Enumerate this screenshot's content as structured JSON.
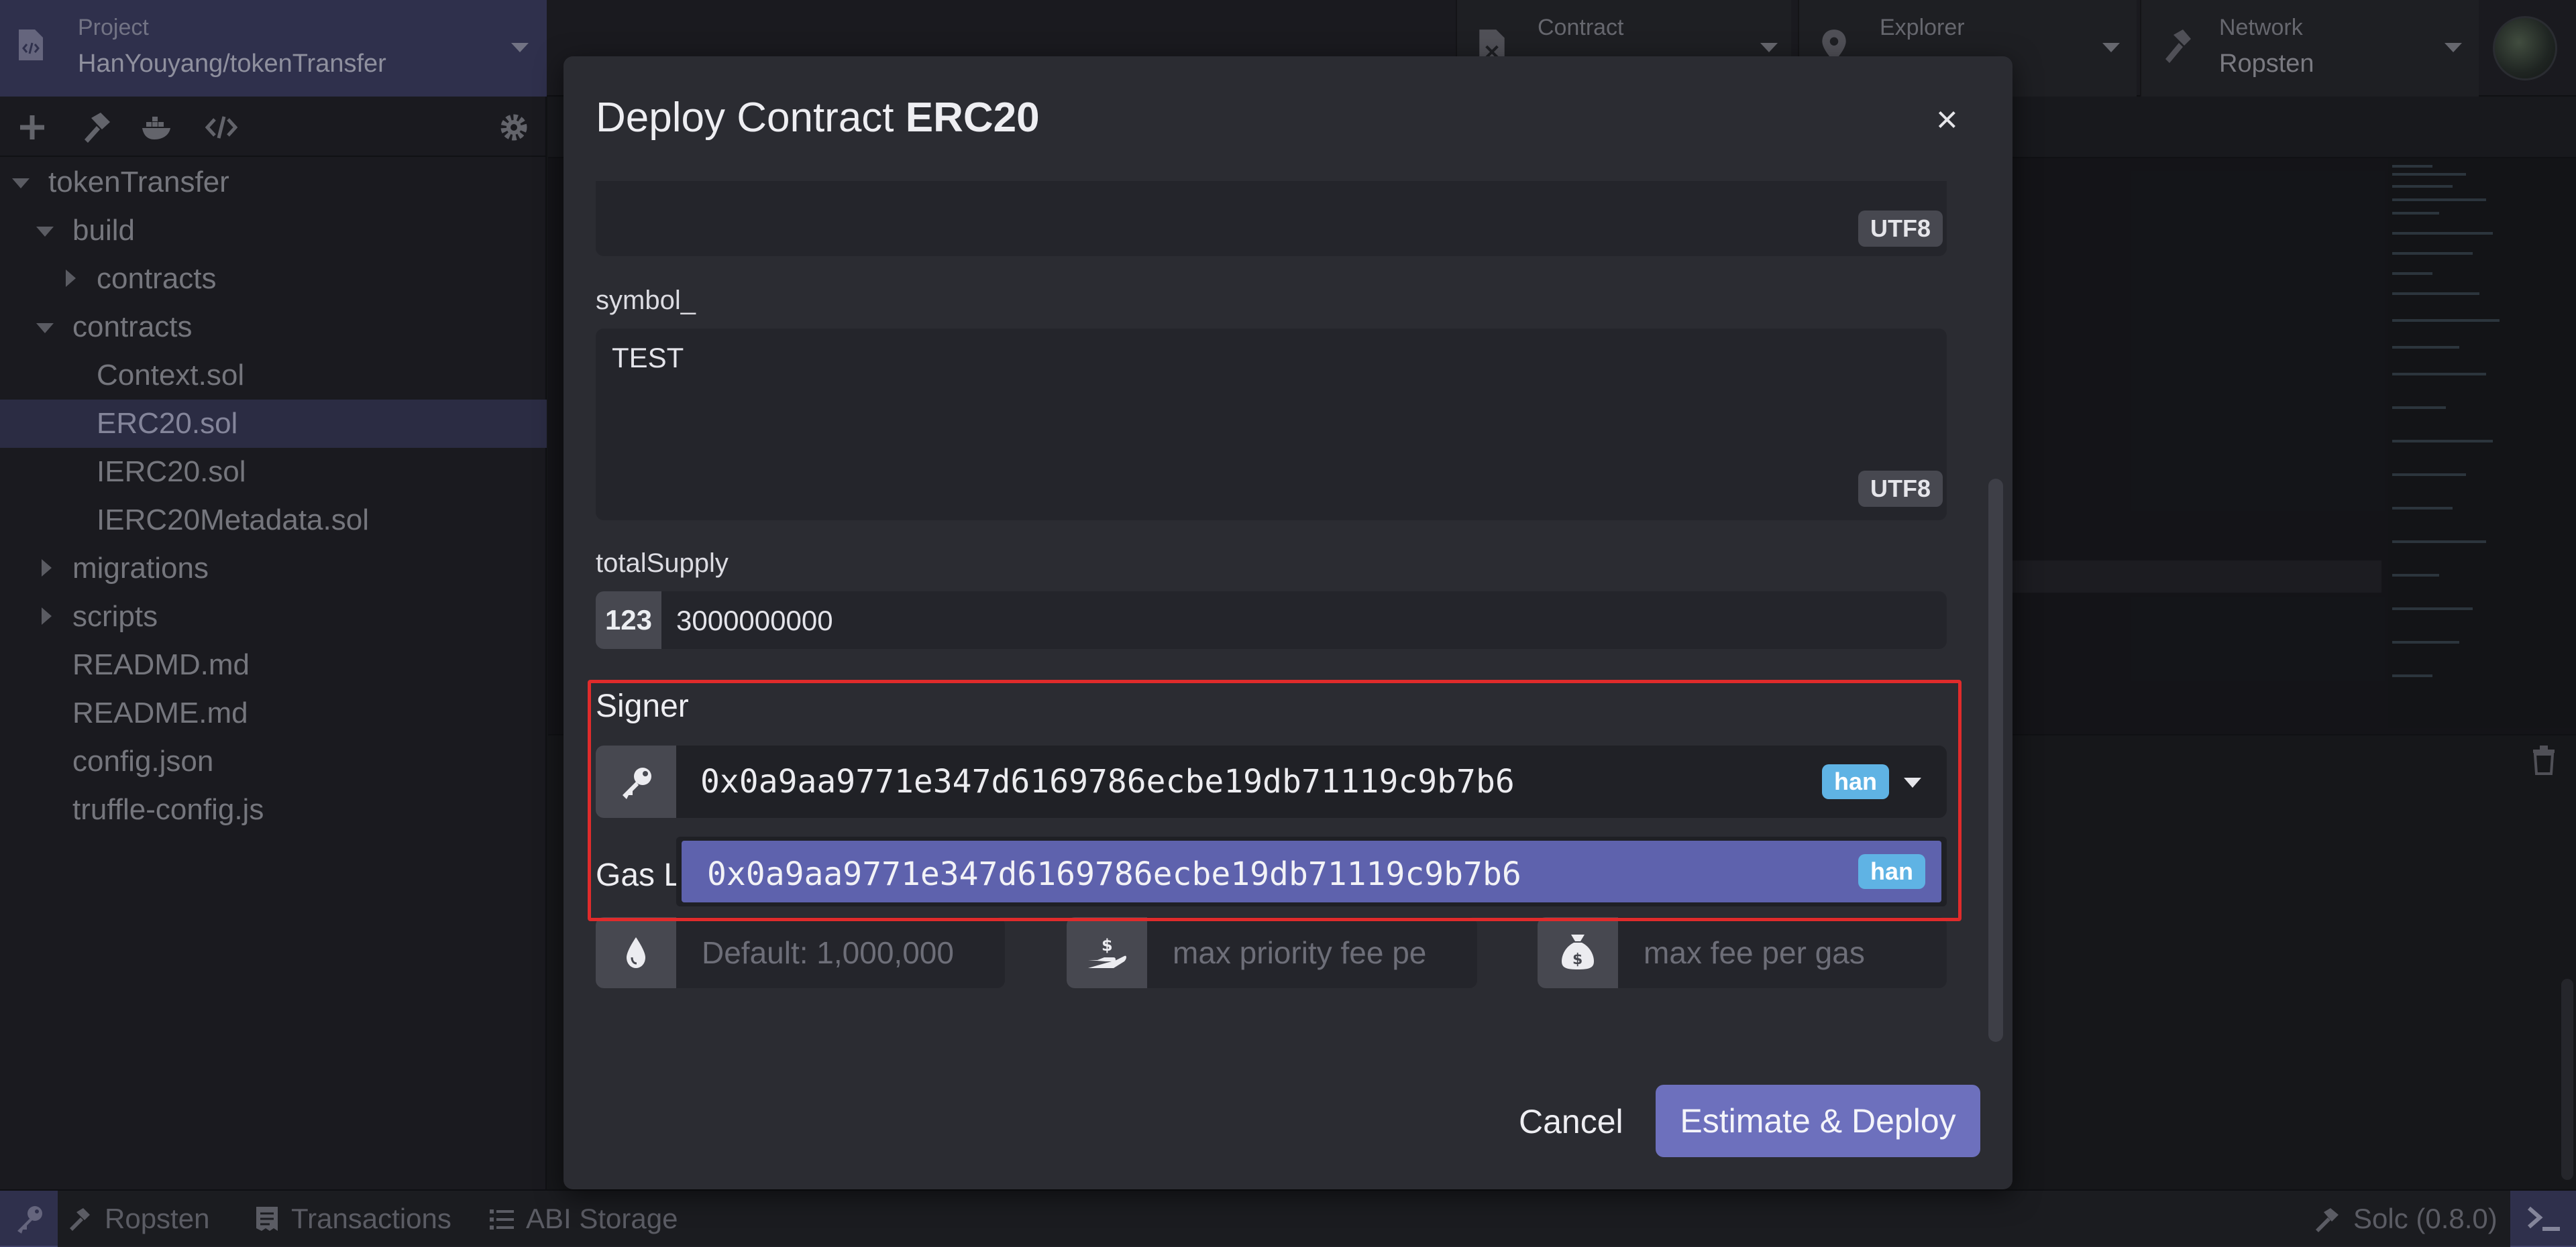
{
  "topbar": {
    "project_label": "Project",
    "project_name": "HanYouyang/tokenTransfer",
    "contract_label": "Contract",
    "explorer_label": "Explorer",
    "network_label": "Network",
    "network_value": "Ropsten"
  },
  "sidebar": {
    "tree": [
      {
        "label": "tokenTransfer",
        "expanded": true
      },
      {
        "label": "build",
        "expanded": true
      },
      {
        "label": "contracts",
        "expanded": false
      },
      {
        "label": "contracts",
        "expanded": true
      },
      {
        "label": "Context.sol"
      },
      {
        "label": "ERC20.sol",
        "selected": true
      },
      {
        "label": "IERC20.sol"
      },
      {
        "label": "IERC20Metadata.sol"
      },
      {
        "label": "migrations",
        "expanded": false
      },
      {
        "label": "scripts",
        "expanded": false
      },
      {
        "label": "READMD.md"
      },
      {
        "label": "README.md"
      },
      {
        "label": "config.json"
      },
      {
        "label": "truffle-config.js"
      }
    ]
  },
  "statusbar": {
    "network": "Ropsten",
    "transactions": "Transactions",
    "abi_storage": "ABI Storage",
    "compiler": "Solc (0.8.0)"
  },
  "modal": {
    "title_prefix": "Deploy Contract",
    "title_contract": "ERC20",
    "close": "×",
    "name_field": {
      "encoding": "UTF8"
    },
    "symbol_field": {
      "label": "symbol_",
      "value": "TEST",
      "encoding": "UTF8"
    },
    "supply_field": {
      "label": "totalSupply",
      "type_badge": "123",
      "value": "3000000000"
    },
    "signer": {
      "label": "Signer",
      "address": "0x0a9aa9771e347d6169786ecbe19db71119c9b7b6",
      "tag": "han"
    },
    "dropdown_options": [
      {
        "address": "0x0a9aa9771e347d6169786ecbe19db71119c9b7b6",
        "tag": "han"
      }
    ],
    "gas_label": "Gas L",
    "gas": {
      "limit_placeholder": "Default: 1,000,000",
      "priority_fee_placeholder": "max priority fee pe",
      "max_fee_placeholder": "max fee per gas"
    },
    "cancel_label": "Cancel",
    "deploy_label": "Estimate & Deploy"
  },
  "colors": {
    "accent": "#6d70bd",
    "highlight_border": "#e02b2b",
    "tag_badge": "#5fb3e4",
    "selected_row": "#3c3d5e"
  }
}
